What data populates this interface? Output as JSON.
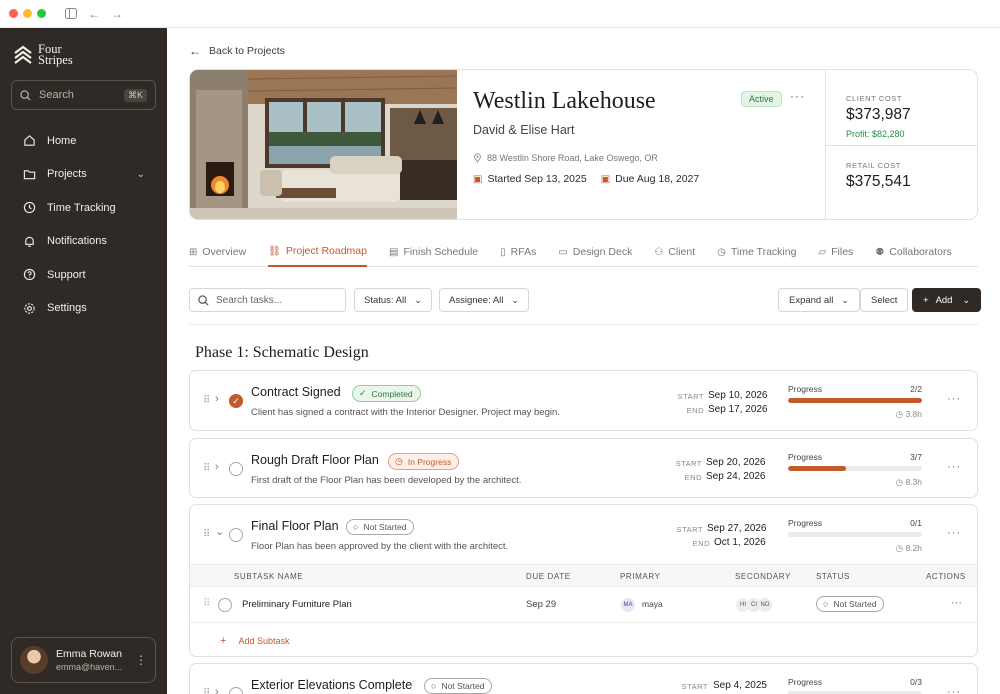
{
  "sidebar": {
    "logo_line1": "Four",
    "logo_line2": "Stripes",
    "search_label": "Search",
    "search_shortcut": "⌘K",
    "nav": [
      {
        "label": "Home",
        "icon": "home-icon"
      },
      {
        "label": "Projects",
        "icon": "folder-icon"
      },
      {
        "label": "Time Tracking",
        "icon": "clock-icon"
      },
      {
        "label": "Notifications",
        "icon": "bell-icon"
      },
      {
        "label": "Support",
        "icon": "help-icon"
      },
      {
        "label": "Settings",
        "icon": "gear-icon"
      }
    ],
    "user": {
      "name": "Emma Rowan",
      "email": "emma@haven..."
    }
  },
  "back_label": "Back to Projects",
  "project": {
    "title": "Westlin Lakehouse",
    "client": "David & Elise Hart",
    "status": "Active",
    "address": "88 Westlin Shore Road, Lake Oswego, OR",
    "started": "Started Sep 13, 2025",
    "due": "Due Aug 18, 2027",
    "client_cost_label": "CLIENT COST",
    "client_cost": "$373,987",
    "profit": "Profit: $82,280",
    "retail_cost_label": "RETAIL COST",
    "retail_cost": "$375,541"
  },
  "tabs": [
    {
      "label": "Overview",
      "icon": "grid-icon"
    },
    {
      "label": "Project Roadmap",
      "icon": "roadmap-icon"
    },
    {
      "label": "Finish Schedule",
      "icon": "clipboard-icon"
    },
    {
      "label": "RFAs",
      "icon": "document-icon"
    },
    {
      "label": "Design Deck",
      "icon": "monitor-icon"
    },
    {
      "label": "Client",
      "icon": "user-icon"
    },
    {
      "label": "Time Tracking",
      "icon": "clock-icon"
    },
    {
      "label": "Files",
      "icon": "folder-icon"
    },
    {
      "label": "Collaborators",
      "icon": "users-icon"
    }
  ],
  "active_tab": "Project Roadmap",
  "toolbar": {
    "search_placeholder": "Search tasks...",
    "status_filter": "Status: All",
    "assignee_filter": "Assignee: All",
    "expand_all": "Expand all",
    "select": "Select",
    "add": "Add"
  },
  "phase_title": "Phase 1: Schematic Design",
  "labels": {
    "start": "START",
    "end": "END",
    "progress": "Progress"
  },
  "tasks": [
    {
      "name": "Contract Signed",
      "status": "Completed",
      "desc": "Client has signed a contract with the Interior Designer. Project may begin.",
      "start": "Sep 10, 2026",
      "end": "Sep 17, 2026",
      "progress": "2/2",
      "progress_fraction": 1.0,
      "hours": "3.8h"
    },
    {
      "name": "Rough Draft Floor Plan",
      "status": "In Progress",
      "desc": "First draft of the Floor Plan has been developed by the architect.",
      "start": "Sep 20, 2026",
      "end": "Sep 24, 2026",
      "progress": "3/7",
      "progress_fraction": 0.43,
      "hours": "8.3h"
    },
    {
      "name": "Final Floor Plan",
      "status": "Not Started",
      "desc": "Floor Plan has been approved by the client with the architect.",
      "start": "Sep 27, 2026",
      "end": "Oct 1, 2026",
      "progress": "0/1",
      "progress_fraction": 0.0,
      "hours": "8.2h"
    },
    {
      "name": "Exterior Elevations Complete",
      "status": "Not Started",
      "start": "Sep 4, 2025",
      "progress": "0/3",
      "progress_fraction": 0.0
    }
  ],
  "subtasks": {
    "headers": {
      "name": "SUBTASK NAME",
      "due": "DUE DATE",
      "primary": "PRIMARY",
      "secondary": "SECONDARY",
      "status": "STATUS",
      "actions": "ACTIONS"
    },
    "rows": [
      {
        "name": "Preliminary Furniture Plan",
        "due": "Sep 29",
        "primary_initials": "MA",
        "primary_name": "maya",
        "secondary": [
          "HI",
          "CI",
          "NO"
        ],
        "status": "Not Started"
      }
    ],
    "add_label": "Add Subtask"
  },
  "colors": {
    "accent": "#c25a2c",
    "sidebar": "#2f2a26",
    "success": "#2d8a47"
  }
}
